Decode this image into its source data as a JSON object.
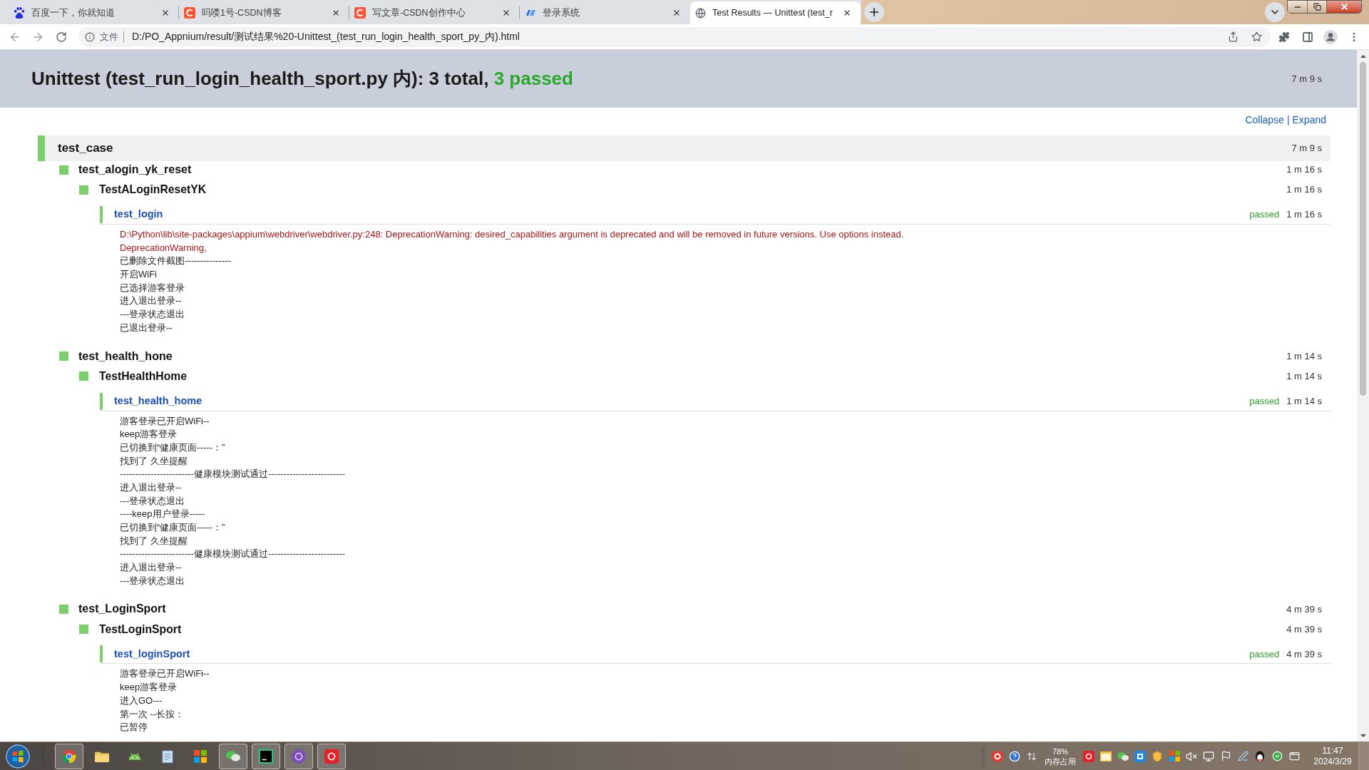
{
  "browser": {
    "tabs": [
      {
        "kind": "paw",
        "title": "百度一下，你就知道",
        "selected": false
      },
      {
        "kind": "letter",
        "title": "吗喽1号-CSDN博客",
        "selected": false
      },
      {
        "kind": "letter",
        "title": "写文章-CSDN创作中心",
        "selected": false
      },
      {
        "kind": "mark",
        "title": "登录系统",
        "selected": false
      },
      {
        "kind": "globe",
        "title": "Test Results — Unittest (test_r",
        "selected": true
      }
    ],
    "address": {
      "chip": "文件",
      "url": "D:/PO_Appnium/result/测试结果%20-Unittest_(test_run_login_health_sport_py_内).html"
    }
  },
  "report": {
    "title": "Unittest (test_run_login_health_sport.py 内): 3 total,",
    "passed_summary": "3 passed",
    "duration": "7 m 9 s",
    "controls": {
      "collapse": "Collapse",
      "separator": "|",
      "expand": "Expand"
    },
    "suite": {
      "name": "test_case",
      "duration": "7 m 9 s",
      "passed": true,
      "children": [
        {
          "name": "test_alogin_yk_reset",
          "duration": "1 m 16 s",
          "passed": true,
          "children": [
            {
              "name": "TestALoginResetYK",
              "duration": "1 m 16 s",
              "passed": true,
              "children": [
                {
                  "name": "test_login",
                  "status": "passed",
                  "duration": "1 m 16 s",
                  "output": [
                    {
                      "kind": "stderr",
                      "text": "D:\\Python\\lib\\site-packages\\appium\\webdriver\\webdriver.py:248: DeprecationWarning: desired_capabilities argument is deprecated and will be removed in future versions. Use options instead."
                    },
                    {
                      "kind": "stderr",
                      "text": "DeprecationWarning,"
                    },
                    {
                      "kind": "stdout",
                      "text": "已删除文件截图---------------"
                    },
                    {
                      "kind": "stdout",
                      "text": "开启WiFi"
                    },
                    {
                      "kind": "stdout",
                      "text": "已选择游客登录"
                    },
                    {
                      "kind": "stdout",
                      "text": "进入退出登录--"
                    },
                    {
                      "kind": "stdout",
                      "text": "---登录状态退出"
                    },
                    {
                      "kind": "stdout",
                      "text": "已退出登录--"
                    }
                  ]
                }
              ]
            }
          ]
        },
        {
          "name": "test_health_hone",
          "duration": "1 m 14 s",
          "passed": true,
          "children": [
            {
              "name": "TestHealthHome",
              "duration": "1 m 14 s",
              "passed": true,
              "children": [
                {
                  "name": "test_health_home",
                  "status": "passed",
                  "duration": "1 m 14 s",
                  "output": [
                    {
                      "kind": "stdout",
                      "text": "游客登录已开启WiFi--"
                    },
                    {
                      "kind": "stdout",
                      "text": "keep游客登录"
                    },
                    {
                      "kind": "stdout",
                      "text": "已切换到“健康页面-----：”"
                    },
                    {
                      "kind": "stdout",
                      "text": "找到了 久坐提醒"
                    },
                    {
                      "kind": "stdout",
                      "text": "------------------------健康模块测试通过-------------------------"
                    },
                    {
                      "kind": "stdout",
                      "text": "进入退出登录--"
                    },
                    {
                      "kind": "stdout",
                      "text": "---登录状态退出"
                    },
                    {
                      "kind": "stdout",
                      "text": "----keep用户登录-----"
                    },
                    {
                      "kind": "stdout",
                      "text": "已切换到“健康页面-----：”"
                    },
                    {
                      "kind": "stdout",
                      "text": "找到了 久坐提醒"
                    },
                    {
                      "kind": "stdout",
                      "text": "------------------------健康模块测试通过-------------------------"
                    },
                    {
                      "kind": "stdout",
                      "text": "进入退出登录--"
                    },
                    {
                      "kind": "stdout",
                      "text": "---登录状态退出"
                    }
                  ]
                }
              ]
            }
          ]
        },
        {
          "name": "test_LoginSport",
          "duration": "4 m 39 s",
          "passed": true,
          "children": [
            {
              "name": "TestLoginSport",
              "duration": "4 m 39 s",
              "passed": true,
              "children": [
                {
                  "name": "test_loginSport",
                  "status": "passed",
                  "duration": "4 m 39 s",
                  "output": [
                    {
                      "kind": "stdout",
                      "text": "游客登录已开启WiFi--"
                    },
                    {
                      "kind": "stdout",
                      "text": "keep游客登录"
                    },
                    {
                      "kind": "stdout",
                      "text": "进入GO---"
                    },
                    {
                      "kind": "stdout",
                      "text": "第一次 --长按："
                    },
                    {
                      "kind": "stdout",
                      "text": "已暂停"
                    }
                  ]
                }
              ]
            }
          ]
        }
      ]
    }
  },
  "taskbar": {
    "apps": [
      {
        "kind": "browser",
        "running": true
      },
      {
        "kind": "folder",
        "running": false
      },
      {
        "kind": "robot",
        "running": false
      },
      {
        "kind": "notepad",
        "running": false
      },
      {
        "kind": "tiles",
        "running": false
      },
      {
        "kind": "chat",
        "running": true
      },
      {
        "kind": "terminal",
        "running": true
      },
      {
        "kind": "disc",
        "running": true
      },
      {
        "kind": "tile",
        "running": true
      }
    ],
    "memory": {
      "percent": "78%",
      "label": "内存占用"
    },
    "clock": {
      "time": "11:47",
      "date": "2024/3/29"
    }
  }
}
